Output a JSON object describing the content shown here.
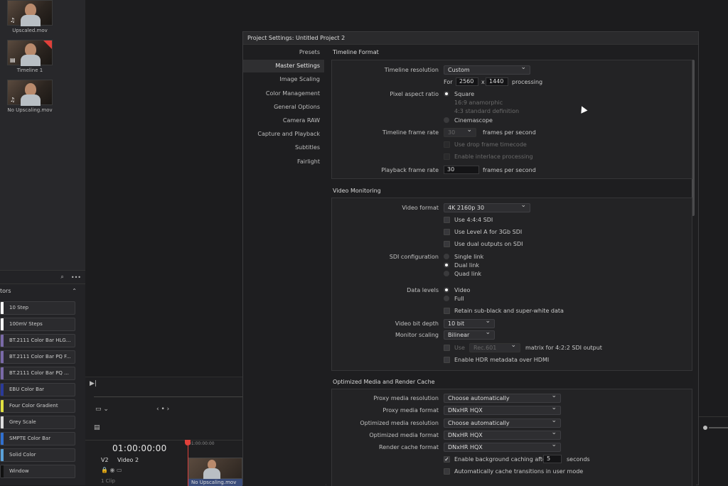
{
  "media_pool": {
    "clips": [
      {
        "name": "Upscaled.mov",
        "badge": "♫"
      },
      {
        "name": "Timeline 1",
        "badge": "▤"
      },
      {
        "name": "No Upscaling.mov",
        "badge": "♫"
      }
    ]
  },
  "effects": {
    "panel_title": "tors",
    "generators": [
      {
        "label": "10 Step",
        "color": "#ffffff"
      },
      {
        "label": "100mV Steps",
        "color": "#ffffff"
      },
      {
        "label": "BT.2111 Color Bar HLG...",
        "color": "#7a6aa8"
      },
      {
        "label": "BT.2111 Color Bar PQ F...",
        "color": "#7a6aa8"
      },
      {
        "label": "BT.2111 Color Bar PQ ...",
        "color": "#7a6aa8"
      },
      {
        "label": "EBU Color Bar",
        "color": "#2a3a9a"
      },
      {
        "label": "Four Color Gradient",
        "color": "#e0e040"
      },
      {
        "label": "Grey Scale",
        "color": "#dddddd"
      },
      {
        "label": "SMPTE Color Bar",
        "color": "#3070d0"
      },
      {
        "label": "Solid Color",
        "color": "#5aa0d8"
      },
      {
        "label": "Window",
        "color": "#111111"
      }
    ]
  },
  "timeline": {
    "timecode": "01:00:00:00",
    "ruler_start": "01:00:00:00",
    "track_id": "V2",
    "track_name": "Video 2",
    "clip_count": "1 Clip",
    "clip_name": "No Upscaling.mov"
  },
  "dialog": {
    "title": "Project Settings:  Untitled Project 2",
    "nav": [
      "Presets",
      "Master Settings",
      "Image Scaling",
      "Color Management",
      "General Options",
      "Camera RAW",
      "Capture and Playback",
      "Subtitles",
      "Fairlight"
    ],
    "selected_nav": "Master Settings",
    "timeline_format": {
      "section": "Timeline Format",
      "resolution_label": "Timeline resolution",
      "resolution_value": "Custom",
      "for_label": "For",
      "width": "2560",
      "x": "x",
      "height": "1440",
      "processing": "processing",
      "par_label": "Pixel aspect ratio",
      "par_options": [
        "Square",
        "16:9 anamorphic",
        "4:3 standard definition",
        "Cinemascope"
      ],
      "fps_label": "Timeline frame rate",
      "fps_value": "30",
      "fps_unit": "frames per second",
      "drop_frame": "Use drop frame timecode",
      "interlace": "Enable interlace processing",
      "playback_label": "Playback frame rate",
      "playback_value": "30",
      "playback_unit": "frames per second"
    },
    "video_monitoring": {
      "section": "Video Monitoring",
      "format_label": "Video format",
      "format_value": "4K 2160p 30",
      "use444": "Use 4:4:4 SDI",
      "levelA": "Use Level A for 3Gb SDI",
      "dual_outputs": "Use dual outputs on SDI",
      "sdi_label": "SDI configuration",
      "sdi_options": [
        "Single link",
        "Dual link",
        "Quad link"
      ],
      "levels_label": "Data levels",
      "levels_options": [
        "Video",
        "Full"
      ],
      "retain": "Retain sub-black and super-white data",
      "bitdepth_label": "Video bit depth",
      "bitdepth_value": "10 bit",
      "scaling_label": "Monitor scaling",
      "scaling_value": "Bilinear",
      "use": "Use",
      "matrix_value": "Rec.601",
      "matrix_suffix": "matrix for 4:2:2 SDI output",
      "hdr": "Enable HDR metadata over HDMI"
    },
    "optimized": {
      "section": "Optimized Media and Render Cache",
      "rows": [
        {
          "label": "Proxy media resolution",
          "value": "Choose automatically"
        },
        {
          "label": "Proxy media format",
          "value": "DNxHR HQX"
        },
        {
          "label": "Optimized media resolution",
          "value": "Choose automatically"
        },
        {
          "label": "Optimized media format",
          "value": "DNxHR HQX"
        },
        {
          "label": "Render cache format",
          "value": "DNxHR HQX"
        }
      ],
      "bg_cache": "Enable background caching after",
      "bg_cache_value": "5",
      "bg_cache_unit": "seconds",
      "auto_cache": "Automatically cache transitions in user mode"
    }
  }
}
